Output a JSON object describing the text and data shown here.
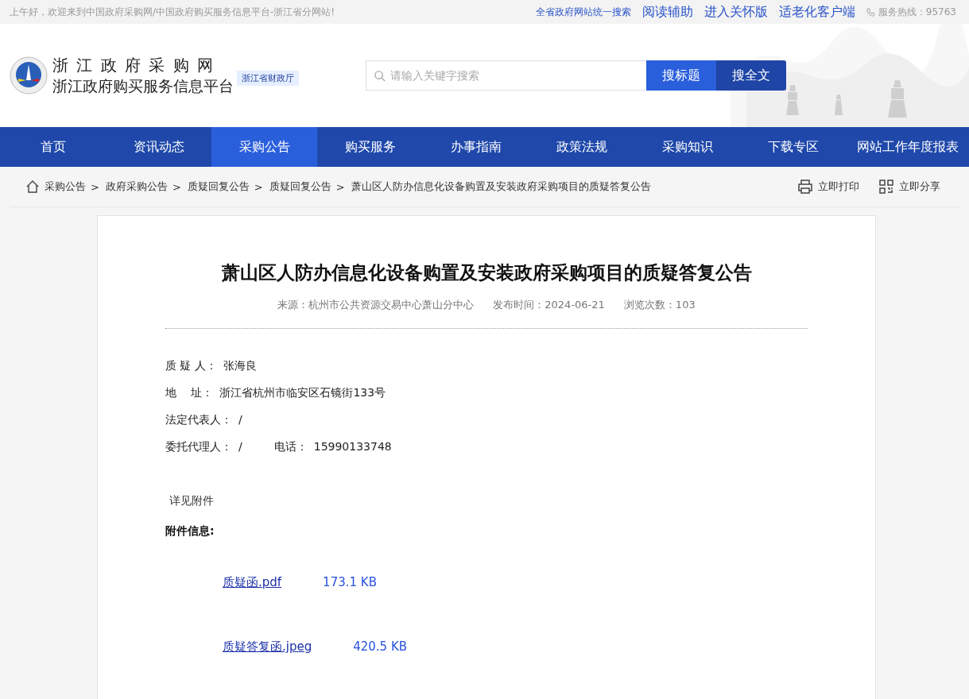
{
  "top_bar": {
    "greeting": "上午好，欢迎来到中国政府采购网/中国政府购买服务信息平台-浙江省分网站!",
    "links": [
      {
        "label": "全省政府网站统一搜索",
        "kind": "search"
      },
      {
        "label": "阅读辅助",
        "kind": "access"
      },
      {
        "label": "进入关怀版",
        "kind": "access"
      },
      {
        "label": "适老化客户端",
        "kind": "access"
      }
    ],
    "hotline": "服务热线：95763"
  },
  "header": {
    "title": "浙 江 政 府 采 购 网",
    "subtitle": "浙江政府购买服务信息平台",
    "badge": "浙江省财政厅",
    "search": {
      "placeholder": "请输入关键字搜索"
    },
    "search_buttons": [
      {
        "label": "搜标题",
        "kind": "primary"
      },
      {
        "label": "搜全文",
        "kind": "dark"
      }
    ]
  },
  "nav": [
    {
      "label": "首页",
      "selected": false
    },
    {
      "label": "资讯动态",
      "selected": false
    },
    {
      "label": "采购公告",
      "selected": true
    },
    {
      "label": "购买服务",
      "selected": false
    },
    {
      "label": "办事指南",
      "selected": false
    },
    {
      "label": "政策法规",
      "selected": false
    },
    {
      "label": "采购知识",
      "selected": false
    },
    {
      "label": "下载专区",
      "selected": false
    },
    {
      "label": "网站工作年度报表",
      "selected": false
    }
  ],
  "breadcrumb": [
    {
      "label": "采购公告",
      "separator": ">"
    },
    {
      "label": "政府采购公告",
      "separator": ">"
    },
    {
      "label": "质疑回复公告",
      "separator": ">"
    },
    {
      "label": "质疑回复公告",
      "separator": ">"
    },
    {
      "label": "萧山区人防办信息化设备购置及安装政府采购项目的质疑答复公告"
    }
  ],
  "actions": [
    {
      "label": "立即打印",
      "kind": "print"
    },
    {
      "label": "立即分享",
      "kind": "share"
    }
  ],
  "article": {
    "title": "萧山区人防办信息化设备购置及安装政府采购项目的质疑答复公告",
    "meta": [
      {
        "label": "来源：",
        "value": "杭州市公共资源交易中心萧山分中心"
      },
      {
        "label": "发布时间：",
        "value": "2024-06-21"
      },
      {
        "label": "浏览次数：",
        "value": "103"
      }
    ],
    "fields": [
      [
        {
          "label": "质 疑 人：",
          "value": "张海良"
        }
      ],
      [
        {
          "label": "地　 址：",
          "value": "浙江省杭州市临安区石镜街133号"
        }
      ],
      [
        {
          "label": "法定代表人：",
          "value": "/"
        }
      ],
      [
        {
          "label": "委托代理人：",
          "value": "/"
        },
        {
          "label": "电话：",
          "value": "15990133748"
        }
      ]
    ],
    "note": "详见附件",
    "attachments_heading": "附件信息:",
    "attachments": [
      {
        "name": "质疑函.pdf",
        "size": "173.1 KB"
      },
      {
        "name": "质疑答复函.jpeg",
        "size": "420.5 KB"
      }
    ]
  }
}
